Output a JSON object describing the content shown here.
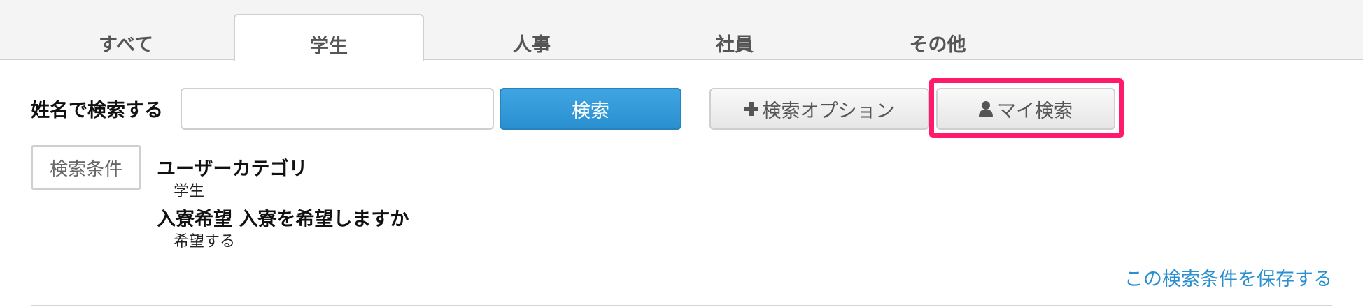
{
  "tabs": [
    {
      "label": "すべて"
    },
    {
      "label": "学生"
    },
    {
      "label": "人事"
    },
    {
      "label": "社員"
    },
    {
      "label": "その他"
    }
  ],
  "search": {
    "label": "姓名で検索する",
    "input_value": "",
    "submit_label": "検索",
    "option_label": "検索オプション",
    "my_search_label": "マイ検索"
  },
  "conditions": {
    "badge": "検索条件",
    "items": [
      {
        "title": "ユーザーカテゴリ",
        "value": "学生"
      },
      {
        "title": "入寮希望 入寮を希望しますか",
        "value": "希望する"
      }
    ],
    "save_link": "この検索条件を保存する"
  },
  "colors": {
    "primary": "#2a8fcf",
    "highlight": "#ff1a6b"
  }
}
